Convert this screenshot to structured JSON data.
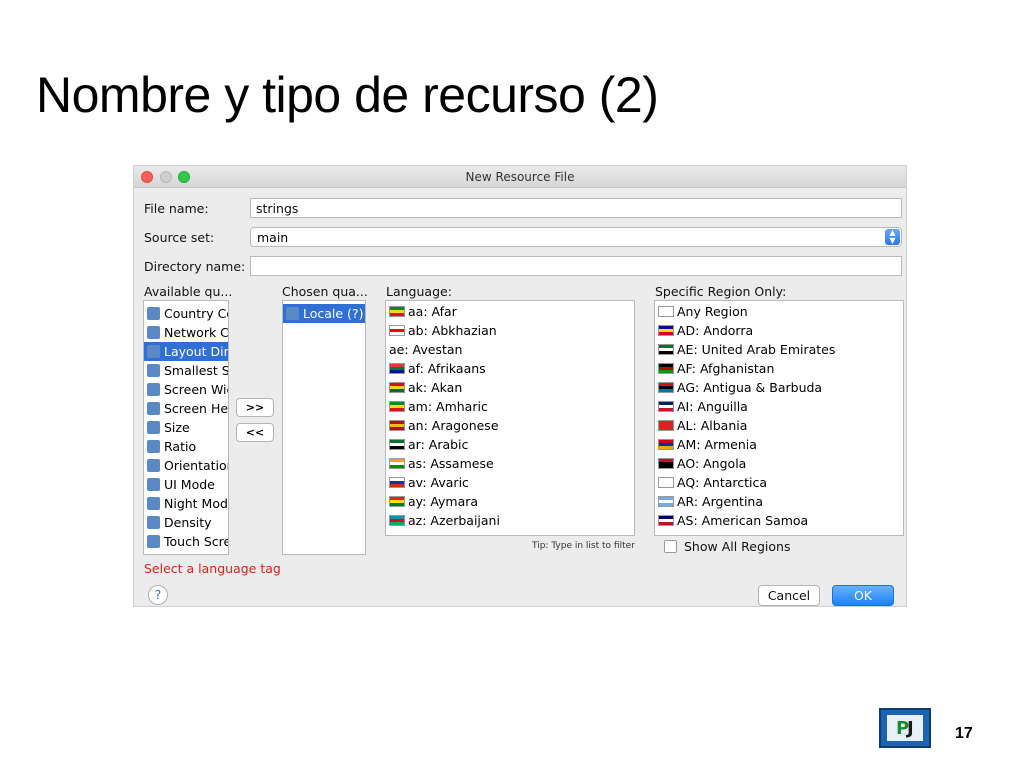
{
  "slide": {
    "title": "Nombre y tipo de recurso (2)",
    "page_number": "17"
  },
  "window": {
    "title": "New Resource File"
  },
  "form": {
    "file_name_label": "File name:",
    "file_name_value": "strings",
    "source_set_label": "Source set:",
    "source_set_value": "main",
    "directory_name_label": "Directory name:",
    "directory_name_value": ""
  },
  "qualifiers": {
    "available_label": "Available qu...",
    "chosen_label": "Chosen qua...",
    "available": [
      {
        "label": "Country Co",
        "icon": "country-code-icon",
        "selected": false
      },
      {
        "label": "Network C",
        "icon": "network-code-icon",
        "selected": false
      },
      {
        "label": "Layout Dir",
        "icon": "layout-direction-icon",
        "selected": true
      },
      {
        "label": "Smallest Sc",
        "icon": "smallest-screen-width-icon",
        "selected": false
      },
      {
        "label": "Screen Wic",
        "icon": "screen-width-icon",
        "selected": false
      },
      {
        "label": "Screen Hei",
        "icon": "screen-height-icon",
        "selected": false
      },
      {
        "label": "Size",
        "icon": "size-icon",
        "selected": false
      },
      {
        "label": "Ratio",
        "icon": "ratio-icon",
        "selected": false
      },
      {
        "label": "Orientation",
        "icon": "orientation-icon",
        "selected": false
      },
      {
        "label": "UI Mode",
        "icon": "ui-mode-icon",
        "selected": false
      },
      {
        "label": "Night Mod",
        "icon": "night-mode-icon",
        "selected": false
      },
      {
        "label": "Density",
        "icon": "density-icon",
        "selected": false
      },
      {
        "label": "Touch Scre",
        "icon": "touch-screen-icon",
        "selected": false
      }
    ],
    "chosen": [
      {
        "label": "Locale (?)",
        "icon": "globe-icon",
        "selected": true
      }
    ],
    "add_button": ">>",
    "remove_button": "<<"
  },
  "language": {
    "label": "Language:",
    "tip": "Tip: Type in list to filter",
    "items": [
      {
        "label": "aa: Afar",
        "flag": "ethiopia-flag-icon",
        "colors": [
          "#078930",
          "#fcdd09",
          "#da121a"
        ]
      },
      {
        "label": "ab: Abkhazian",
        "flag": "georgia-flag-icon",
        "colors": [
          "#ffffff",
          "#ff0000",
          "#ffffff"
        ]
      },
      {
        "label": "ae: Avestan",
        "flag": "",
        "colors": []
      },
      {
        "label": "af: Afrikaans",
        "flag": "south-africa-flag-icon",
        "colors": [
          "#e03c31",
          "#007749",
          "#001489"
        ]
      },
      {
        "label": "ak: Akan",
        "flag": "ghana-flag-icon",
        "colors": [
          "#ce1126",
          "#fcd116",
          "#006b3f"
        ]
      },
      {
        "label": "am: Amharic",
        "flag": "ethiopia-flag-icon",
        "colors": [
          "#078930",
          "#fcdd09",
          "#da121a"
        ]
      },
      {
        "label": "an: Aragonese",
        "flag": "spain-flag-icon",
        "colors": [
          "#aa151b",
          "#f1bf00",
          "#aa151b"
        ]
      },
      {
        "label": "ar: Arabic",
        "flag": "uae-flag-icon",
        "colors": [
          "#00732f",
          "#ffffff",
          "#000000"
        ]
      },
      {
        "label": "as: Assamese",
        "flag": "india-flag-icon",
        "colors": [
          "#ff9933",
          "#ffffff",
          "#138808"
        ]
      },
      {
        "label": "av: Avaric",
        "flag": "russia-flag-icon",
        "colors": [
          "#ffffff",
          "#0039a6",
          "#d52b1e"
        ]
      },
      {
        "label": "ay: Aymara",
        "flag": "bolivia-flag-icon",
        "colors": [
          "#d52b1e",
          "#f9e300",
          "#007934"
        ]
      },
      {
        "label": "az: Azerbaijani",
        "flag": "azerbaijan-flag-icon",
        "colors": [
          "#0092bc",
          "#e4002b",
          "#00af66"
        ]
      }
    ]
  },
  "region": {
    "label": "Specific Region Only:",
    "show_all_label": "Show All Regions",
    "items": [
      {
        "label": "Any Region",
        "flag": "blank-flag-icon",
        "colors": [
          "#ffffff",
          "#ffffff",
          "#ffffff"
        ]
      },
      {
        "label": "AD: Andorra",
        "flag": "andorra-flag-icon",
        "colors": [
          "#10069f",
          "#fedd00",
          "#d50032"
        ]
      },
      {
        "label": "AE: United Arab Emirates",
        "flag": "uae-flag-icon",
        "colors": [
          "#00732f",
          "#ffffff",
          "#000000"
        ]
      },
      {
        "label": "AF: Afghanistan",
        "flag": "afghanistan-flag-icon",
        "colors": [
          "#000000",
          "#be0000",
          "#009900"
        ]
      },
      {
        "label": "AG: Antigua & Barbuda",
        "flag": "antigua-flag-icon",
        "colors": [
          "#ce1126",
          "#000000",
          "#0072c6"
        ]
      },
      {
        "label": "AI: Anguilla",
        "flag": "anguilla-flag-icon",
        "colors": [
          "#012169",
          "#ffffff",
          "#c8102e"
        ]
      },
      {
        "label": "AL: Albania",
        "flag": "albania-flag-icon",
        "colors": [
          "#e41e20",
          "#e41e20",
          "#e41e20"
        ]
      },
      {
        "label": "AM: Armenia",
        "flag": "armenia-flag-icon",
        "colors": [
          "#d90012",
          "#0033a0",
          "#f2a800"
        ]
      },
      {
        "label": "AO: Angola",
        "flag": "angola-flag-icon",
        "colors": [
          "#cc092f",
          "#000000",
          "#000000"
        ]
      },
      {
        "label": "AQ: Antarctica",
        "flag": "antarctica-flag-icon",
        "colors": [
          "#ffffff",
          "#ffffff",
          "#ffffff"
        ]
      },
      {
        "label": "AR: Argentina",
        "flag": "argentina-flag-icon",
        "colors": [
          "#74acdf",
          "#ffffff",
          "#74acdf"
        ]
      },
      {
        "label": "AS: American Samoa",
        "flag": "american-samoa-flag-icon",
        "colors": [
          "#000066",
          "#ffffff",
          "#bd1021"
        ]
      }
    ]
  },
  "footer": {
    "error_text": "Select a language tag",
    "help_label": "?",
    "cancel_label": "Cancel",
    "ok_label": "OK"
  },
  "colors": {
    "accent": "#2f6fd6",
    "error": "#e3201c",
    "ok_button": "#1a82f7"
  }
}
